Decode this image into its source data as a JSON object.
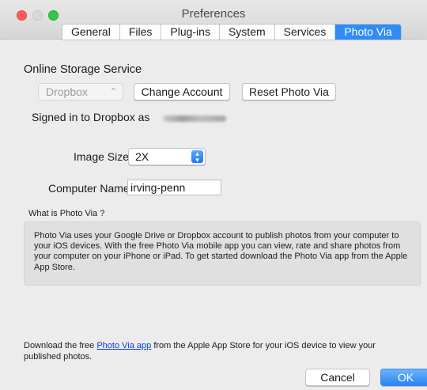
{
  "window": {
    "title": "Preferences"
  },
  "tabs": [
    "General",
    "Files",
    "Plug-ins",
    "System",
    "Services",
    "Photo Via"
  ],
  "active_tab": "Photo Via",
  "online_storage": {
    "title": "Online Storage Service",
    "service_select": "Dropbox",
    "change_account_label": "Change Account",
    "reset_label": "Reset Photo Via",
    "signed_in_text": "Signed in to Dropbox as"
  },
  "image_size": {
    "label": "Image Size",
    "value": "2X"
  },
  "computer_name": {
    "label": "Computer Name",
    "value": "irving-penn"
  },
  "what_is": {
    "heading": "What is Photo Via ?",
    "body": "Photo Via uses your Google Drive or Dropbox account to publish photos from your computer to your iOS devices. With the free Photo Via mobile app you can view, rate and share photos from your computer on your iPhone or iPad. To get started download the Photo Via app from the Apple App Store."
  },
  "footer": {
    "text_before": "Download the free ",
    "link": "Photo Via app",
    "text_after": " from the Apple App Store for your iOS device to view your published photos."
  },
  "buttons": {
    "cancel": "Cancel",
    "ok": "OK"
  },
  "colors": {
    "accent": "#2f8cf7",
    "link": "#0a3fe0"
  }
}
